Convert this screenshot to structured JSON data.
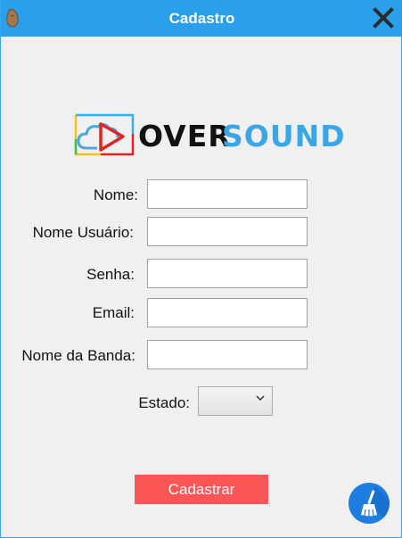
{
  "window": {
    "title": "Cadastro"
  },
  "logo": {
    "word1": "OVER",
    "word2": "SOUND"
  },
  "form": {
    "nome": {
      "label": "Nome:",
      "value": ""
    },
    "usuario": {
      "label": "Nome Usuário:",
      "value": ""
    },
    "senha": {
      "label": "Senha:",
      "value": ""
    },
    "email": {
      "label": "Email:",
      "value": ""
    },
    "banda": {
      "label": "Nome da Banda:",
      "value": ""
    },
    "estado": {
      "label": "Estado:",
      "value": ""
    }
  },
  "actions": {
    "submit_label": "Cadastrar"
  },
  "icons": {
    "app": "brown-bag-icon",
    "close": "close-icon",
    "clear": "broom-icon"
  },
  "colors": {
    "titlebar": "#2aa0ec",
    "submit": "#fb5656",
    "accent": "#3aa6e8",
    "clear_button": "#1d7ee0"
  }
}
